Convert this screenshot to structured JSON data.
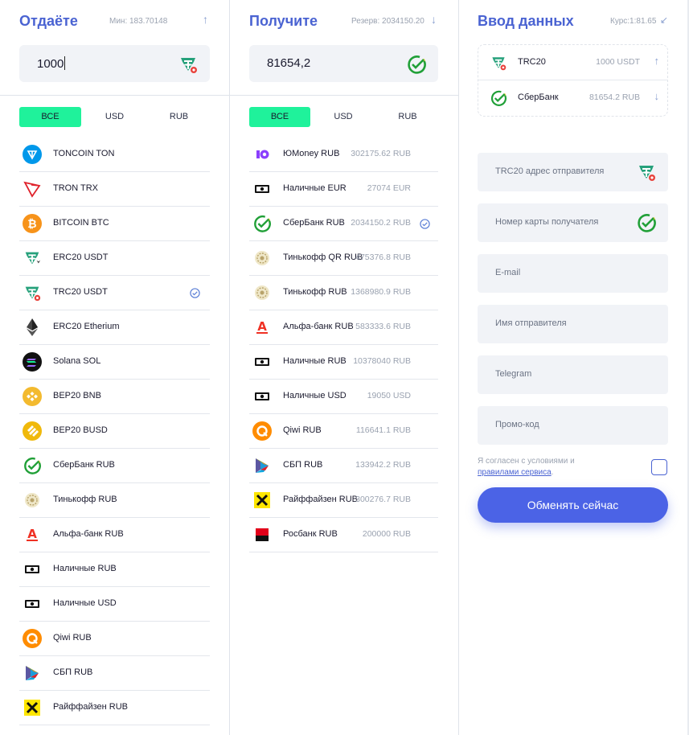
{
  "give": {
    "title": "Отдаёте",
    "min": "Мин: 183.70148",
    "arrow": "↑",
    "amount": "1000",
    "icon": "tether-trc20-icon",
    "filters": [
      "ВСЕ",
      "USD",
      "RUB"
    ],
    "active_filter": "ВСЕ",
    "items": [
      {
        "name": "TONCOIN TON",
        "icon": "toncoin-icon"
      },
      {
        "name": "TRON TRX",
        "icon": "tron-icon"
      },
      {
        "name": "BITCOIN BTC",
        "icon": "bitcoin-icon"
      },
      {
        "name": "ERC20 USDT",
        "icon": "tether-erc20-icon"
      },
      {
        "name": "TRC20 USDT",
        "icon": "tether-trc20-icon",
        "selected": true
      },
      {
        "name": "ERC20 Etherium",
        "icon": "ethereum-icon"
      },
      {
        "name": "Solana SOL",
        "icon": "solana-icon"
      },
      {
        "name": "BEP20 BNB",
        "icon": "bnb-icon"
      },
      {
        "name": "BEP20 BUSD",
        "icon": "busd-icon"
      },
      {
        "name": "СберБанк RUB",
        "icon": "sberbank-icon"
      },
      {
        "name": "Тинькофф RUB",
        "icon": "tinkoff-icon"
      },
      {
        "name": "Альфа-банк RUB",
        "icon": "alfabank-icon"
      },
      {
        "name": "Наличные RUB",
        "icon": "cash-icon"
      },
      {
        "name": "Наличные USD",
        "icon": "cash-icon"
      },
      {
        "name": "Qiwi RUB",
        "icon": "qiwi-icon"
      },
      {
        "name": "СБП RUB",
        "icon": "sbp-icon"
      },
      {
        "name": "Райффайзен RUB",
        "icon": "raiffeisen-icon"
      }
    ]
  },
  "receive": {
    "title": "Получите",
    "reserve": "Резерв: 2034150.20",
    "arrow": "↓",
    "amount": "81654,2",
    "icon": "sberbank-icon",
    "filters": [
      "ВСЕ",
      "USD",
      "RUB"
    ],
    "active_filter": "ВСЕ",
    "items": [
      {
        "name": "ЮMoney RUB",
        "reserve": "302175.62 RUB",
        "icon": "yoomoney-icon"
      },
      {
        "name": "Наличные EUR",
        "reserve": "27074 EUR",
        "icon": "cash-icon"
      },
      {
        "name": "СберБанк RUB",
        "reserve": "2034150.2 RUB",
        "icon": "sberbank-icon",
        "selected": true
      },
      {
        "name": "Тинькофф QR RUB",
        "reserve": "475376.8 RUB",
        "icon": "tinkoff-icon"
      },
      {
        "name": "Тинькофф RUB",
        "reserve": "1368980.9 RUB",
        "icon": "tinkoff-icon"
      },
      {
        "name": "Альфа-банк RUB",
        "reserve": "583333.6 RUB",
        "icon": "alfabank-icon"
      },
      {
        "name": "Наличные RUB",
        "reserve": "10378040 RUB",
        "icon": "cash-icon"
      },
      {
        "name": "Наличные USD",
        "reserve": "19050 USD",
        "icon": "cash-icon"
      },
      {
        "name": "Qiwi RUB",
        "reserve": "116641.1 RUB",
        "icon": "qiwi-icon"
      },
      {
        "name": "СБП RUB",
        "reserve": "133942.2 RUB",
        "icon": "sbp-icon"
      },
      {
        "name": "Райффайзен RUB",
        "reserve": "300276.7 RUB",
        "icon": "raiffeisen-icon"
      },
      {
        "name": "Росбанк RUB",
        "reserve": "200000 RUB",
        "icon": "rosbank-icon"
      }
    ]
  },
  "data_entry": {
    "title": "Ввод данных",
    "rate": "Курс:1:81.65",
    "rate_arrow": "↙",
    "summary": [
      {
        "name": "TRC20",
        "amount": "1000 USDT",
        "arrow": "↑",
        "icon": "tether-trc20-icon"
      },
      {
        "name": "СберБанк",
        "amount": "81654.2 RUB",
        "arrow": "↓",
        "icon": "sberbank-icon"
      }
    ],
    "fields": [
      {
        "placeholder": "TRC20 адрес отправителя",
        "icon": "tether-trc20-icon"
      },
      {
        "placeholder": "Номер карты получателя",
        "icon": "sberbank-icon"
      },
      {
        "placeholder": "E-mail"
      },
      {
        "placeholder": "Имя отправителя"
      },
      {
        "placeholder": "Telegram"
      },
      {
        "placeholder": "Промо-код"
      }
    ],
    "agree_text": "Я согласен с условиями и",
    "agree_link": "правилами сервиса",
    "agree_suffix": ".",
    "submit": "Обменять сейчас"
  },
  "colors": {
    "accent": "#4a63d2",
    "button": "#4b63e6",
    "filter_active": "#1ff29b",
    "muted": "#9aa2b0",
    "field_bg": "#f1f3f7"
  }
}
